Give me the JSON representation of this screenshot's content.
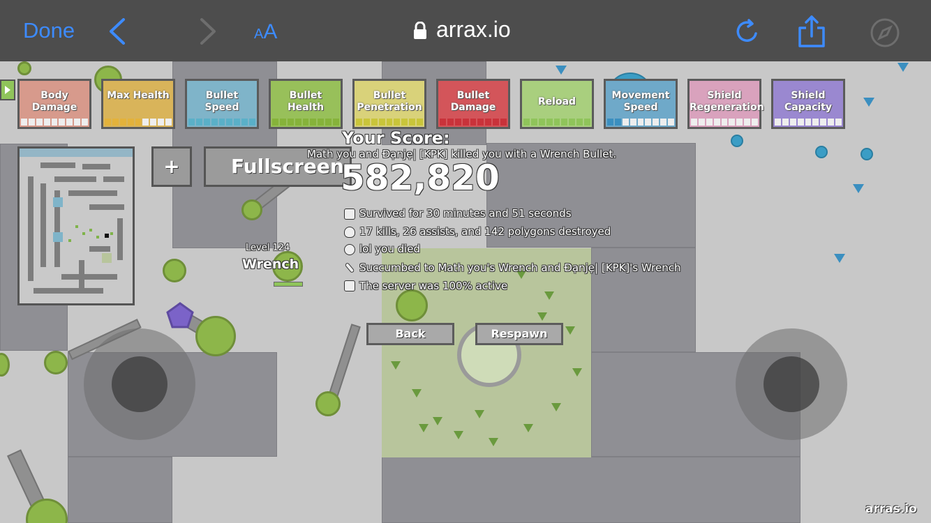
{
  "browser": {
    "done_label": "Done",
    "text_size_label_small": "A",
    "text_size_label_large": "A",
    "url": "arrax.io"
  },
  "upgrades": [
    {
      "label": "Body Damage",
      "color": "#d79a8c",
      "filled": 0,
      "tick_color": "#eeeeee"
    },
    {
      "label": "Max Health",
      "color": "#d9b45a",
      "filled": 5,
      "tick_color": "#e3b23b"
    },
    {
      "label": "Bullet Speed",
      "color": "#7fb4c9",
      "filled": 9,
      "tick_color": "#5ab0c8"
    },
    {
      "label": "Bullet Health",
      "color": "#98c05a",
      "filled": 9,
      "tick_color": "#86b33a"
    },
    {
      "label": "Bullet Penetration",
      "color": "#d9d27a",
      "filled": 9,
      "tick_color": "#c9c53a"
    },
    {
      "label": "Bullet Damage",
      "color": "#d3555a",
      "filled": 9,
      "tick_color": "#c9323a"
    },
    {
      "label": "Reload",
      "color": "#a9cf7e",
      "filled": 9,
      "tick_color": "#8fc45a"
    },
    {
      "label": "Movement Speed",
      "color": "#6fa9c9",
      "filled": 2,
      "tick_color": "#3b8fc0"
    },
    {
      "label": "Shield Regeneration",
      "color": "#d9a2bd",
      "filled": 0,
      "tick_color": "#eeeeee"
    },
    {
      "label": "Shield Capacity",
      "color": "#9a88d0",
      "filled": 0,
      "tick_color": "#eeeeee"
    }
  ],
  "buttons": {
    "plus": "+",
    "fullscreen": "Fullscreen",
    "back": "Back",
    "respawn": "Respawn"
  },
  "death_screen": {
    "title": "Your Score:",
    "killer_message": "Math you and Đạnjẹ| [KPK] killed you with a Wrench Bullet.",
    "score": "582,820",
    "stats": [
      {
        "icon": "clock-icon",
        "text": "Survived for 30 minutes and 51 seconds"
      },
      {
        "icon": "flame-icon",
        "text": "17 kills, 26 assists, and 142 polygons destroyed"
      },
      {
        "icon": "skull-icon",
        "text": "lol you died"
      },
      {
        "icon": "sword-icon",
        "text": "Succumbed to Math you's Wrench and Đạnjẹ| [KPK]'s Wrench"
      },
      {
        "icon": "server-icon",
        "text": "The server was 100% active"
      }
    ]
  },
  "player": {
    "level": "Level 124",
    "class_name": "Wrench"
  },
  "logo": "arras.io"
}
